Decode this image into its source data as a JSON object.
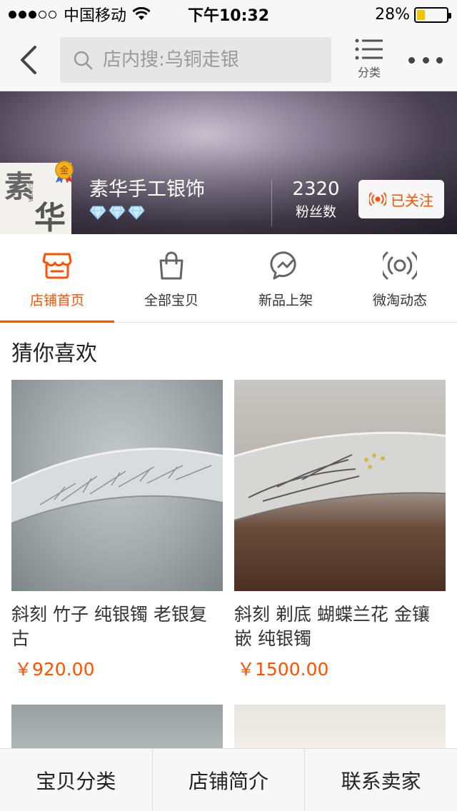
{
  "status_bar": {
    "carrier": "中国移动",
    "time": "下午10:32",
    "battery": "28%",
    "battery_level": 0.28,
    "signal_bars": 3
  },
  "nav": {
    "search_placeholder": "店内搜:乌铜走银",
    "category_label": "分类"
  },
  "shop": {
    "logo_text": "素华",
    "badge": "金",
    "name": "素华手工银饰",
    "diamonds": 3,
    "fans_count": "2320",
    "fans_label": "粉丝数",
    "follow_label": "已关注"
  },
  "tabs": [
    {
      "label": "店铺首页",
      "icon": "store-icon",
      "active": true
    },
    {
      "label": "全部宝贝",
      "icon": "shopping-bag-icon",
      "active": false
    },
    {
      "label": "新品上架",
      "icon": "new-arrival-icon",
      "active": false
    },
    {
      "label": "微淘动态",
      "icon": "broadcast-icon",
      "active": false
    }
  ],
  "recommend": {
    "title": "猜你喜欢",
    "products": [
      {
        "name": "斜刻 竹子 纯银镯 老银复古",
        "price": "￥920.00"
      },
      {
        "name": "斜刻 剃底 蝴蝶兰花 金镶嵌 纯银镯",
        "price": "￥1500.00"
      }
    ]
  },
  "bottom_bar": {
    "items": [
      "宝贝分类",
      "店铺简介",
      "联系卖家"
    ]
  },
  "colors": {
    "accent": "#ff5000",
    "battery": "#f5c400"
  }
}
